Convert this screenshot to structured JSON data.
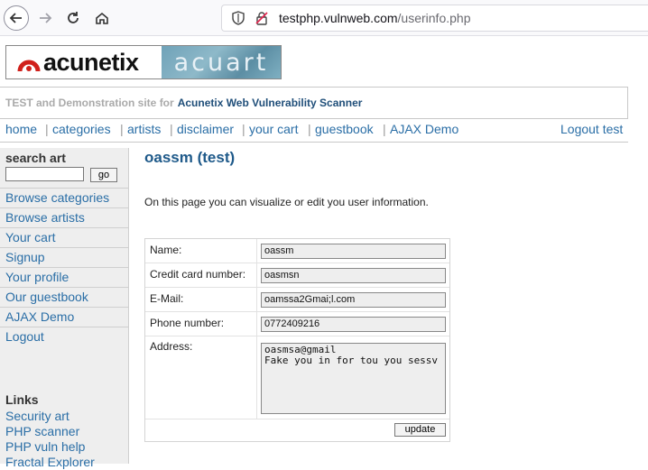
{
  "browser": {
    "url_host": "testphp.vulnweb.com",
    "url_path": "/userinfo.php"
  },
  "site": {
    "logo_text": "acunetix",
    "acuart_text": "acuart",
    "tagline_prefix": "TEST and Demonstration site for",
    "tagline_brand": "Acunetix Web Vulnerability Scanner"
  },
  "topnav": {
    "items": [
      "home",
      "categories",
      "artists",
      "disclaimer",
      "your cart",
      "guestbook",
      "AJAX Demo"
    ],
    "logout": "Logout test"
  },
  "sidebar": {
    "search_label": "search art",
    "search_value": "",
    "go_label": "go",
    "items": [
      "Browse categories",
      "Browse artists",
      "Your cart",
      "Signup",
      "Your profile",
      "Our guestbook",
      "AJAX Demo",
      "Logout"
    ],
    "links_heading": "Links",
    "links": [
      "Security art",
      "PHP scanner",
      "PHP vuln help",
      "Fractal Explorer"
    ]
  },
  "main": {
    "title": "oassm (test)",
    "intro": "On this page you can visualize or edit you user information.",
    "fields": {
      "name_label": "Name:",
      "name_value": "oassm",
      "cc_label": "Credit card number:",
      "cc_value": "oasmsn",
      "email_label": "E-Mail:",
      "email_value": "oamssa2Gmai;l.com",
      "phone_label": "Phone number:",
      "phone_value": "0772409216",
      "address_label": "Address:",
      "address_value": "oasmsa@gmail\nFake you in for tou you sessv"
    },
    "update_label": "update"
  }
}
